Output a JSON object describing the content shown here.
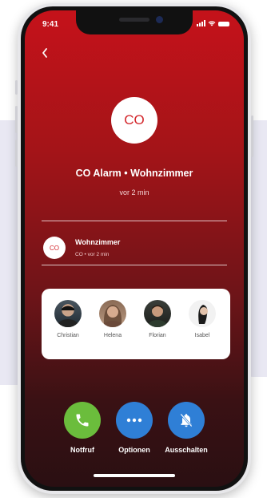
{
  "status": {
    "time": "9:41"
  },
  "alarm": {
    "badge": "CO",
    "title": "CO Alarm • Wohnzimmer",
    "time_ago": "vor 2 min"
  },
  "room": {
    "badge": "CO",
    "name": "Wohnzimmer",
    "subtitle": "CO • vor 2 min"
  },
  "contacts": [
    {
      "name": "Christian"
    },
    {
      "name": "Helena"
    },
    {
      "name": "Florian"
    },
    {
      "name": "Isabel"
    }
  ],
  "actions": [
    {
      "label": "Notfruf",
      "icon": "phone-icon",
      "color": "#6bbd3c"
    },
    {
      "label": "Optionen",
      "icon": "more-icon",
      "color": "#2f7fd6"
    },
    {
      "label": "Ausschalten",
      "icon": "bell-off-icon",
      "color": "#2f7fd6"
    }
  ],
  "colors": {
    "accent_red": "#c5121a",
    "call_green": "#6bbd3c",
    "action_blue": "#2f7fd6"
  }
}
